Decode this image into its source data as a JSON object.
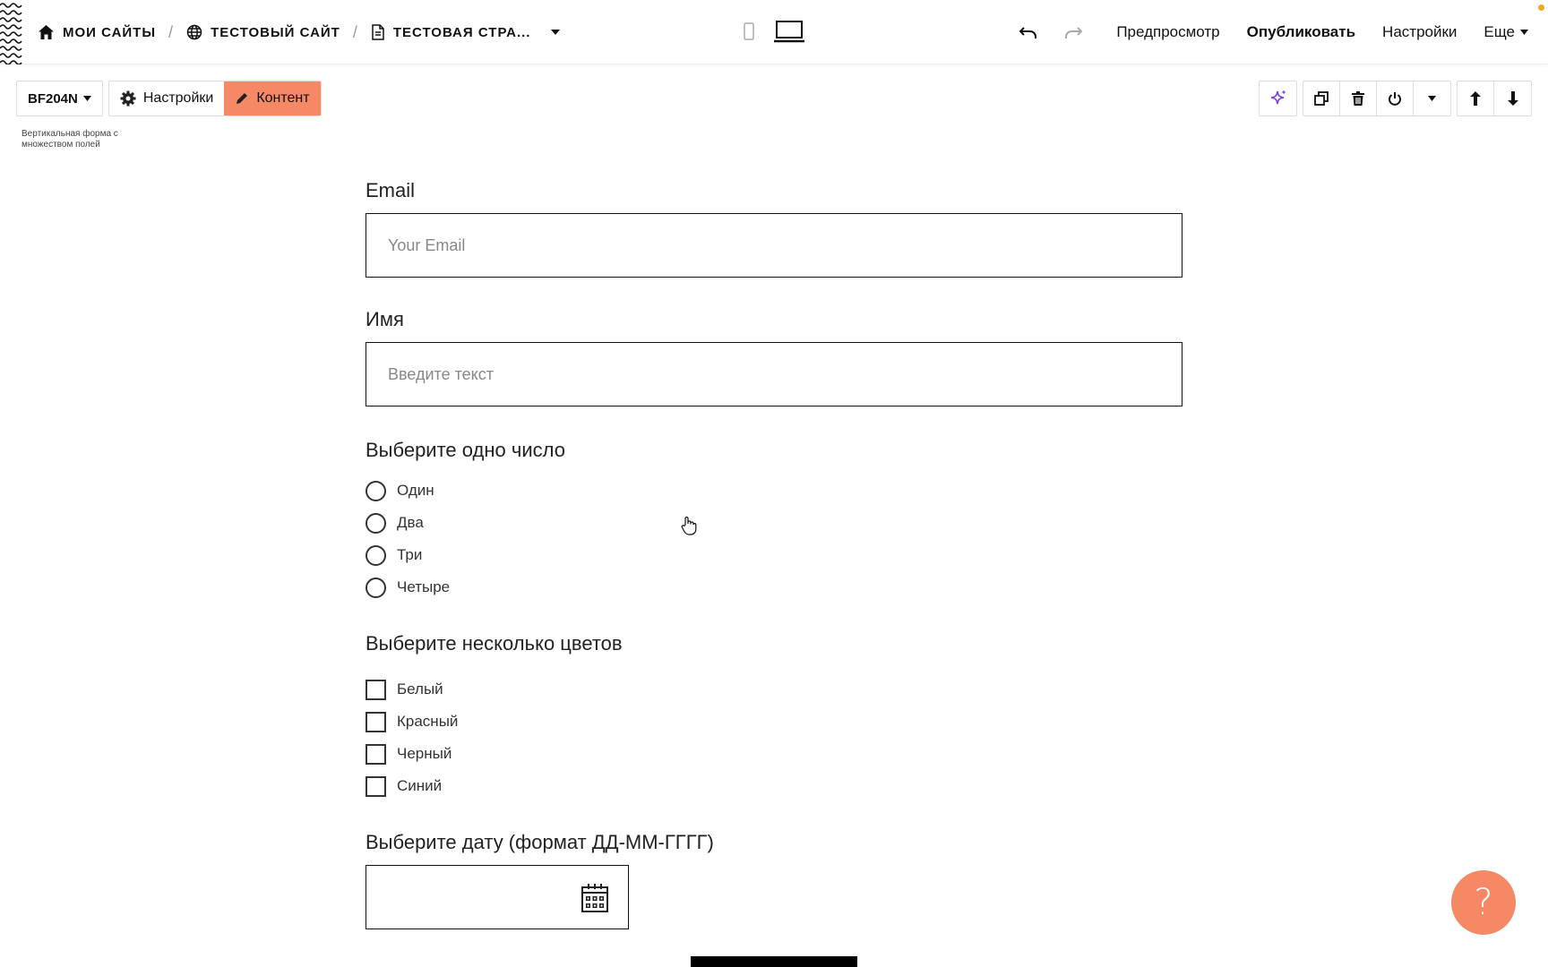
{
  "breadcrumbs": {
    "my_sites": "МОИ САЙТЫ",
    "test_site": "ТЕСТОВЫЙ САЙТ",
    "test_page": "ТЕСТОВАЯ СТРА..."
  },
  "topbar": {
    "preview": "Предпросмотр",
    "publish": "Опубликовать",
    "settings": "Настройки",
    "more": "Еще"
  },
  "block": {
    "id": "BF204N",
    "settings_tab": "Настройки",
    "content_tab": "Контент",
    "description": "Вертикальная форма с множеством полей"
  },
  "form": {
    "email_label": "Email",
    "email_placeholder": "Your Email",
    "name_label": "Имя",
    "name_placeholder": "Введите текст",
    "radio_label": "Выберите одно число",
    "radio_options": [
      "Один",
      "Два",
      "Три",
      "Четыре"
    ],
    "checkbox_label": "Выберите несколько цветов",
    "checkbox_options": [
      "Белый",
      "Красный",
      "Черный",
      "Синий"
    ],
    "date_label": "Выберите дату (формат ДД-ММ-ГГГГ)"
  },
  "help": {
    "symbol": "?"
  },
  "colors": {
    "accent": "#f58966",
    "notification": "#f5a623",
    "ai_icon": "#7b3fe4"
  },
  "icons": [
    "home-icon",
    "globe-icon",
    "page-icon",
    "mobile-icon",
    "desktop-icon",
    "undo-icon",
    "redo-icon",
    "gear-icon",
    "pencil-icon",
    "sparkle-icon",
    "duplicate-icon",
    "trash-icon",
    "power-icon",
    "arrow-up-icon",
    "arrow-down-icon",
    "calendar-icon",
    "question-icon"
  ]
}
